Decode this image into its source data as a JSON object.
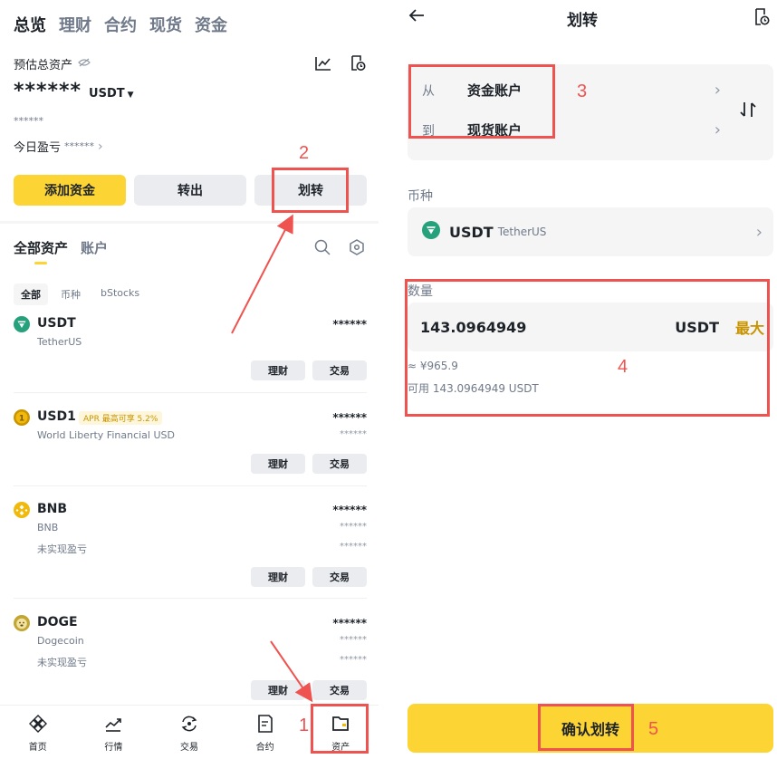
{
  "left": {
    "top_tabs": [
      "总览",
      "理财",
      "合约",
      "现货",
      "资金"
    ],
    "est_label": "预估总资产",
    "balance_stars": "******",
    "balance_currency": "USDT",
    "sub_stars": "******",
    "pnl_label": "今日盈亏",
    "pnl_stars": "******",
    "buttons": {
      "add": "添加资金",
      "withdraw": "转出",
      "transfer": "划转"
    },
    "asset_tabs": [
      "全部资产",
      "账户"
    ],
    "chips": [
      "全部",
      "币种",
      "bStocks"
    ],
    "assets": [
      {
        "sym": "USDT",
        "name": "TetherUS",
        "val": "******",
        "val2": "",
        "pnl_label": "",
        "val3": "",
        "apr": ""
      },
      {
        "sym": "USD1",
        "name": "World Liberty Financial USD",
        "val": "******",
        "val2": "******",
        "pnl_label": "",
        "val3": "",
        "apr": "APR 最高可享 5.2%"
      },
      {
        "sym": "BNB",
        "name": "BNB",
        "val": "******",
        "val2": "******",
        "pnl_label": "未实现盈亏",
        "val3": "******",
        "apr": ""
      },
      {
        "sym": "DOGE",
        "name": "Dogecoin",
        "val": "******",
        "val2": "******",
        "pnl_label": "未实现盈亏",
        "val3": "******",
        "apr": ""
      }
    ],
    "actions": {
      "earn": "理财",
      "trade": "交易"
    },
    "nav": [
      "首页",
      "行情",
      "交易",
      "合约",
      "资产"
    ],
    "colors": {
      "accent": "#fcd535",
      "usdt": "#26a17b",
      "usd1": "#c99400",
      "bnb": "#f0b90b",
      "doge": "#c2a633"
    }
  },
  "right": {
    "title": "划转",
    "from_label": "从",
    "from_value": "资金账户",
    "to_label": "到",
    "to_value": "现货账户",
    "coin_label": "币种",
    "coin_sym": "USDT",
    "coin_full": "TetherUS",
    "qty_label": "数量",
    "qty_value": "143.0964949",
    "qty_unit": "USDT",
    "qty_max": "最大",
    "approx": "≈ ¥965.9",
    "available": "可用 143.0964949 USDT",
    "confirm": "确认划转"
  },
  "annotations": [
    "1",
    "2",
    "3",
    "4",
    "5"
  ]
}
